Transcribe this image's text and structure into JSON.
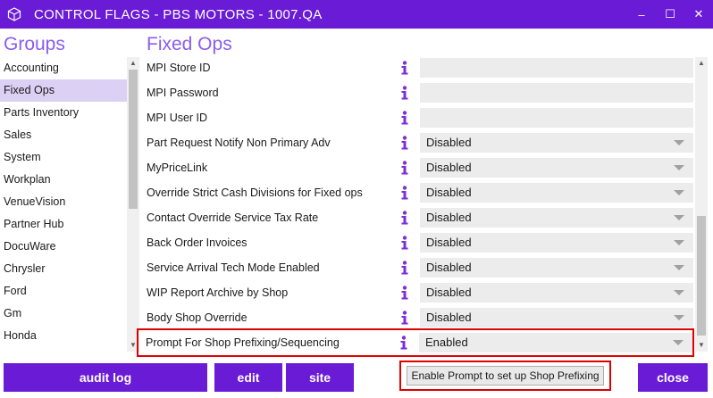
{
  "window": {
    "title": "CONTROL FLAGS - PBS MOTORS - 1007.QA",
    "min_glyph": "–",
    "max_glyph": "☐",
    "close_glyph": "✕"
  },
  "sidebar": {
    "title": "Groups",
    "items": [
      {
        "label": "Accounting",
        "selected": false
      },
      {
        "label": "Fixed Ops",
        "selected": true
      },
      {
        "label": "Parts Inventory",
        "selected": false
      },
      {
        "label": "Sales",
        "selected": false
      },
      {
        "label": "System",
        "selected": false
      },
      {
        "label": "Workplan",
        "selected": false
      },
      {
        "label": "VenueVision",
        "selected": false
      },
      {
        "label": "Partner Hub",
        "selected": false
      },
      {
        "label": "DocuWare",
        "selected": false
      },
      {
        "label": "Chrysler",
        "selected": false
      },
      {
        "label": "Ford",
        "selected": false
      },
      {
        "label": "Gm",
        "selected": false
      },
      {
        "label": "Honda",
        "selected": false
      }
    ]
  },
  "main": {
    "title": "Fixed Ops",
    "rows": [
      {
        "label": "MPI Store ID",
        "type": "text",
        "value": ""
      },
      {
        "label": "MPI Password",
        "type": "text",
        "value": ""
      },
      {
        "label": "MPI User ID",
        "type": "text",
        "value": ""
      },
      {
        "label": "Part Request Notify Non Primary Adv",
        "type": "select",
        "value": "Disabled"
      },
      {
        "label": "MyPriceLink",
        "type": "select",
        "value": "Disabled"
      },
      {
        "label": "Override Strict Cash Divisions for Fixed ops",
        "type": "select",
        "value": "Disabled"
      },
      {
        "label": "Contact Override Service Tax Rate",
        "type": "select",
        "value": "Disabled"
      },
      {
        "label": "Back Order Invoices",
        "type": "select",
        "value": "Disabled"
      },
      {
        "label": "Service Arrival Tech Mode Enabled",
        "type": "select",
        "value": "Disabled"
      },
      {
        "label": "WIP Report Archive by Shop",
        "type": "select",
        "value": "Disabled"
      },
      {
        "label": "Body Shop Override",
        "type": "select",
        "value": "Disabled"
      },
      {
        "label": "Prompt For Shop Prefixing/Sequencing",
        "type": "select",
        "value": "Enabled",
        "highlighted": true
      }
    ]
  },
  "footer": {
    "audit_log": "audit log",
    "edit": "edit",
    "site": "site",
    "enable_prompt": "Enable Prompt to set up Shop Prefixing",
    "close": "close"
  },
  "colors": {
    "accent": "#6a1bd6",
    "heading": "#8a5cf0",
    "selected_bg": "#dcd0f5",
    "highlight_border": "#e00000",
    "info_icon": "#7b2fd8"
  },
  "icons": {
    "app": "cube-icon",
    "info": "info-icon",
    "dropdown": "chevron-down-icon"
  }
}
